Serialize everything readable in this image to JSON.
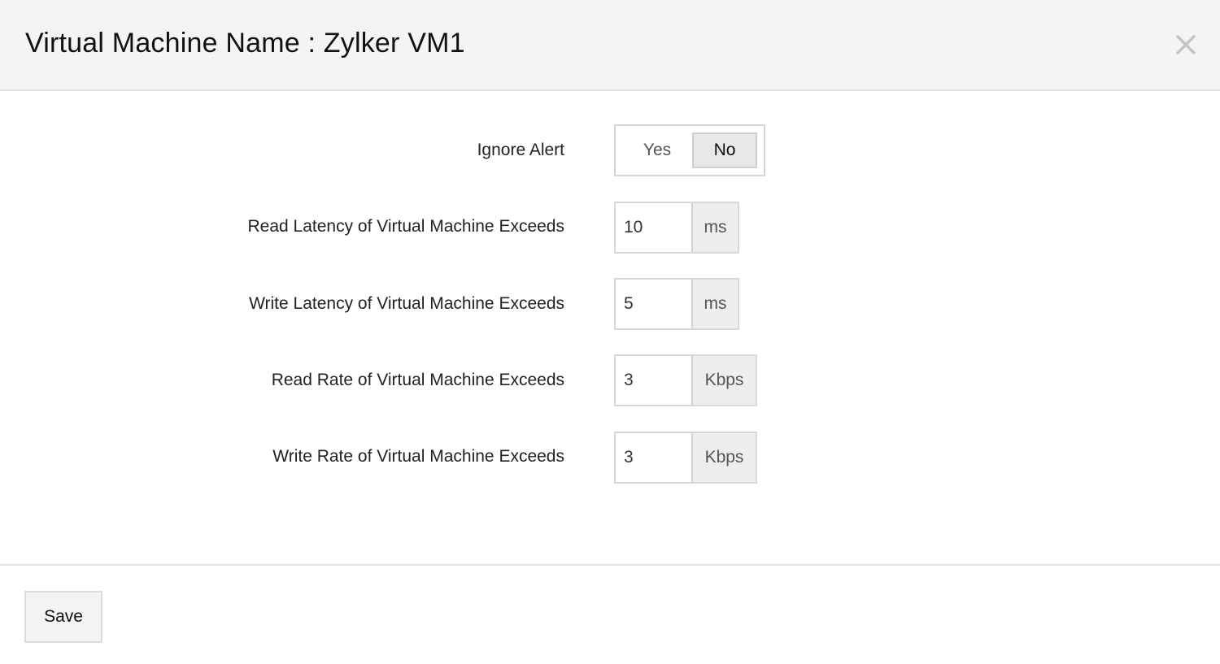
{
  "header": {
    "title": "Virtual Machine Name : Zylker VM1",
    "close_icon": "close-icon"
  },
  "form": {
    "ignore_alert": {
      "label": "Ignore Alert",
      "options": [
        "Yes",
        "No"
      ],
      "selected": "No"
    },
    "fields": [
      {
        "label": "Read Latency of Virtual Machine Exceeds",
        "value": "10",
        "unit": "ms"
      },
      {
        "label": "Write Latency of Virtual Machine Exceeds",
        "value": "5",
        "unit": "ms"
      },
      {
        "label": "Read Rate of Virtual Machine Exceeds",
        "value": "3",
        "unit": "Kbps"
      },
      {
        "label": "Write Rate of Virtual Machine Exceeds",
        "value": "3",
        "unit": "Kbps"
      }
    ]
  },
  "footer": {
    "save_label": "Save"
  }
}
